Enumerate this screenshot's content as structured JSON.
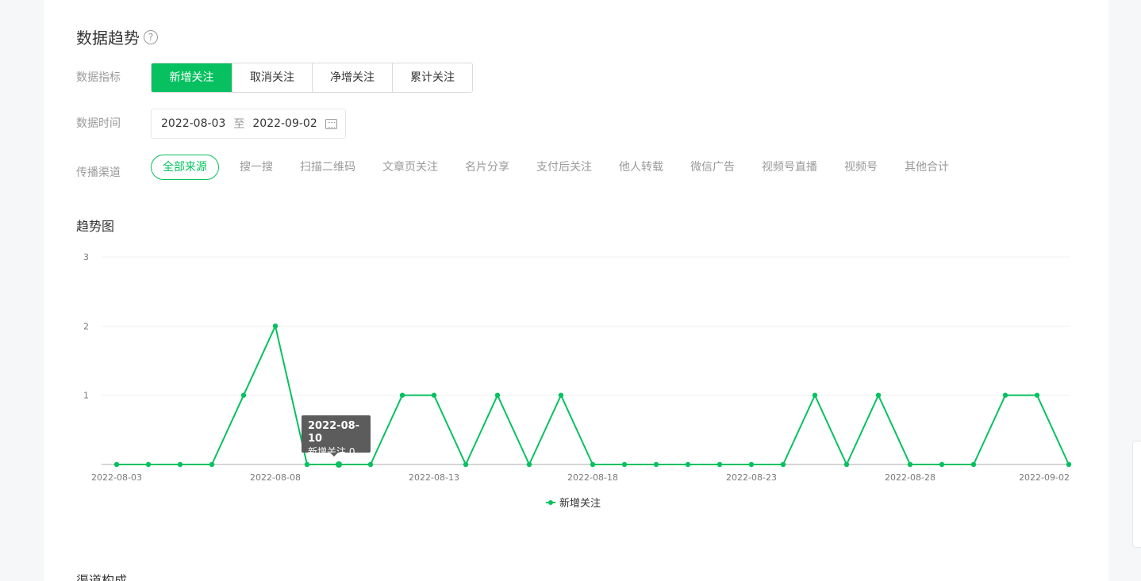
{
  "section": {
    "title": "数据趋势",
    "help_glyph": "?"
  },
  "metrics": {
    "label": "数据指标",
    "items": [
      "新增关注",
      "取消关注",
      "净增关注",
      "累计关注"
    ],
    "active_index": 0
  },
  "date_range": {
    "label": "数据时间",
    "start": "2022-08-03",
    "separator": "至",
    "end": "2022-09-02"
  },
  "channels": {
    "label": "传播渠道",
    "items": [
      "全部来源",
      "搜一搜",
      "扫描二维码",
      "文章页关注",
      "名片分享",
      "支付后关注",
      "他人转载",
      "微信广告",
      "视频号直播",
      "视频号",
      "其他合计"
    ],
    "active_index": 0
  },
  "chart_title": "趋势图",
  "tooltip": {
    "date": "2022-08-10",
    "series": "新增关注",
    "value": "0"
  },
  "sub_title": "渠道构成",
  "chart_data": {
    "type": "line",
    "x": [
      "2022-08-03",
      "2022-08-04",
      "2022-08-05",
      "2022-08-06",
      "2022-08-07",
      "2022-08-08",
      "2022-08-09",
      "2022-08-10",
      "2022-08-11",
      "2022-08-12",
      "2022-08-13",
      "2022-08-14",
      "2022-08-15",
      "2022-08-16",
      "2022-08-17",
      "2022-08-18",
      "2022-08-19",
      "2022-08-20",
      "2022-08-21",
      "2022-08-22",
      "2022-08-23",
      "2022-08-24",
      "2022-08-25",
      "2022-08-26",
      "2022-08-27",
      "2022-08-28",
      "2022-08-29",
      "2022-08-30",
      "2022-08-31",
      "2022-09-01",
      "2022-09-02"
    ],
    "x_tick_labels": [
      "2022-08-03",
      "2022-08-08",
      "2022-08-13",
      "2022-08-18",
      "2022-08-23",
      "2022-08-28",
      "2022-09-02"
    ],
    "series": [
      {
        "name": "新增关注",
        "values": [
          0,
          0,
          0,
          0,
          1,
          2,
          0,
          0,
          0,
          1,
          1,
          0,
          1,
          0,
          1,
          0,
          0,
          0,
          0,
          0,
          0,
          0,
          1,
          0,
          1,
          0,
          0,
          0,
          1,
          1,
          0
        ]
      }
    ],
    "y_ticks": [
      1,
      2,
      3
    ],
    "ylim": [
      0,
      3
    ],
    "grid": true,
    "color": "#07c160",
    "legend_position": "bottom-center",
    "tooltip_index": 7
  }
}
